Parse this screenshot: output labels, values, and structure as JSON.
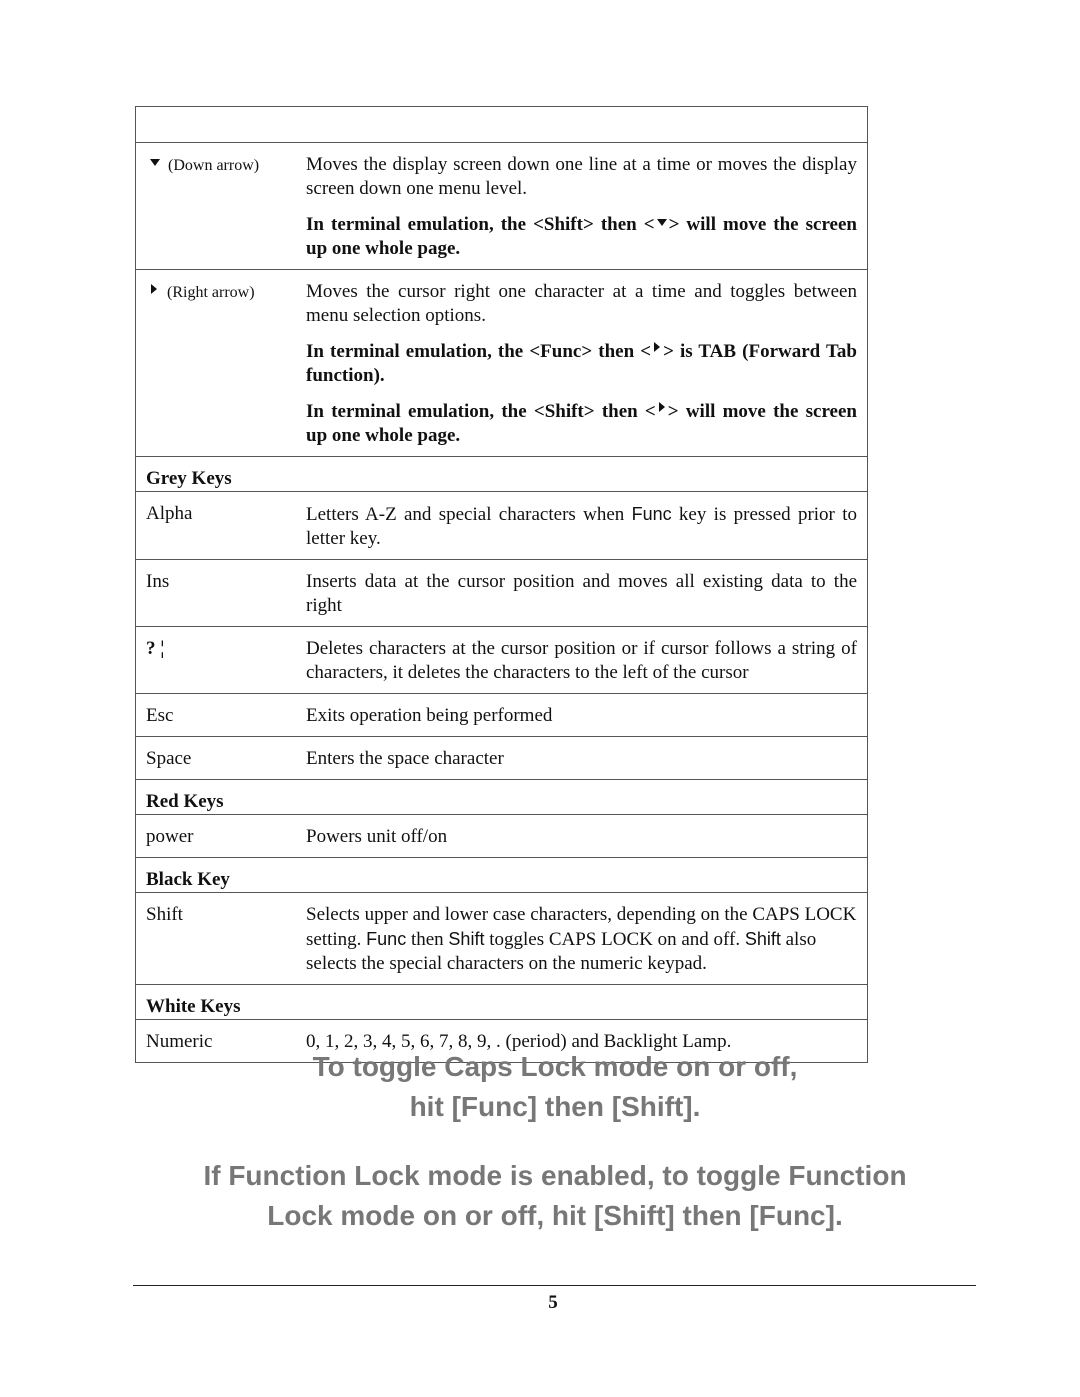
{
  "table": {
    "arrow_rows": [
      {
        "key_icon": "down-arrow-icon",
        "key_label": "(Down arrow)",
        "description": "Moves the display screen down one line at a time or moves the display screen down one menu level.",
        "notes": [
          {
            "before": "In terminal emulation, the <Shift> then <",
            "icon": "down-arrow-icon",
            "after": "> will move the screen up one whole page."
          }
        ]
      },
      {
        "key_icon": "right-arrow-icon",
        "key_label": "(Right arrow)",
        "description": "Moves the cursor right one character at a time and toggles between menu selection options.",
        "notes": [
          {
            "before": "In terminal emulation, the <Func> then <",
            "icon": "right-arrow-icon",
            "after": "> is TAB (Forward Tab function)."
          },
          {
            "before": "In terminal emulation, the <Shift> then <",
            "icon": "right-arrow-icon",
            "after": "> will move the screen up one whole page."
          }
        ]
      }
    ],
    "grey_keys": {
      "heading": "Grey Keys",
      "rows": [
        {
          "key": "Alpha",
          "desc_parts": [
            "Letters A-Z and special characters when ",
            "Func",
            " key is pressed prior to letter key."
          ]
        },
        {
          "key": "Ins",
          "description": "Inserts data at the cursor position and moves all existing data to the right"
        },
        {
          "key": "? ¦",
          "description": "Deletes characters at the cursor position or if cursor follows a string of characters, it deletes the characters to the left of the cursor"
        },
        {
          "key": "Esc",
          "description": "Exits operation being performed"
        },
        {
          "key": "Space",
          "description": "Enters the space character"
        }
      ]
    },
    "red_keys": {
      "heading": "Red Keys",
      "rows": [
        {
          "key": "power",
          "description": "Powers unit off/on"
        }
      ]
    },
    "black_key": {
      "heading": "Black Key",
      "rows": [
        {
          "key": "Shift",
          "desc_parts": [
            "Selects upper and lower case characters, depending on the CAPS LOCK setting. ",
            "Func",
            " then ",
            "Shift",
            " toggles CAPS LOCK on and off. ",
            "Shift",
            " also selects the special characters on the numeric keypad."
          ]
        }
      ]
    },
    "white_keys": {
      "heading": "White Keys",
      "rows": [
        {
          "key": "Numeric",
          "description": "0, 1, 2, 3, 4, 5, 6, 7, 8, 9, . (period) and Backlight Lamp."
        }
      ]
    }
  },
  "notices": {
    "caps_lock": [
      "To toggle Caps Lock mode on or off,",
      "hit [Func] then [Shift]."
    ],
    "function_lock": [
      "If Function Lock mode is enabled, to toggle Function",
      "Lock mode on or off, hit [Shift] then [Func]."
    ]
  },
  "footer": {
    "page_number": "5"
  },
  "colors": {
    "notice_text": "#777777",
    "rule": "#555555"
  }
}
